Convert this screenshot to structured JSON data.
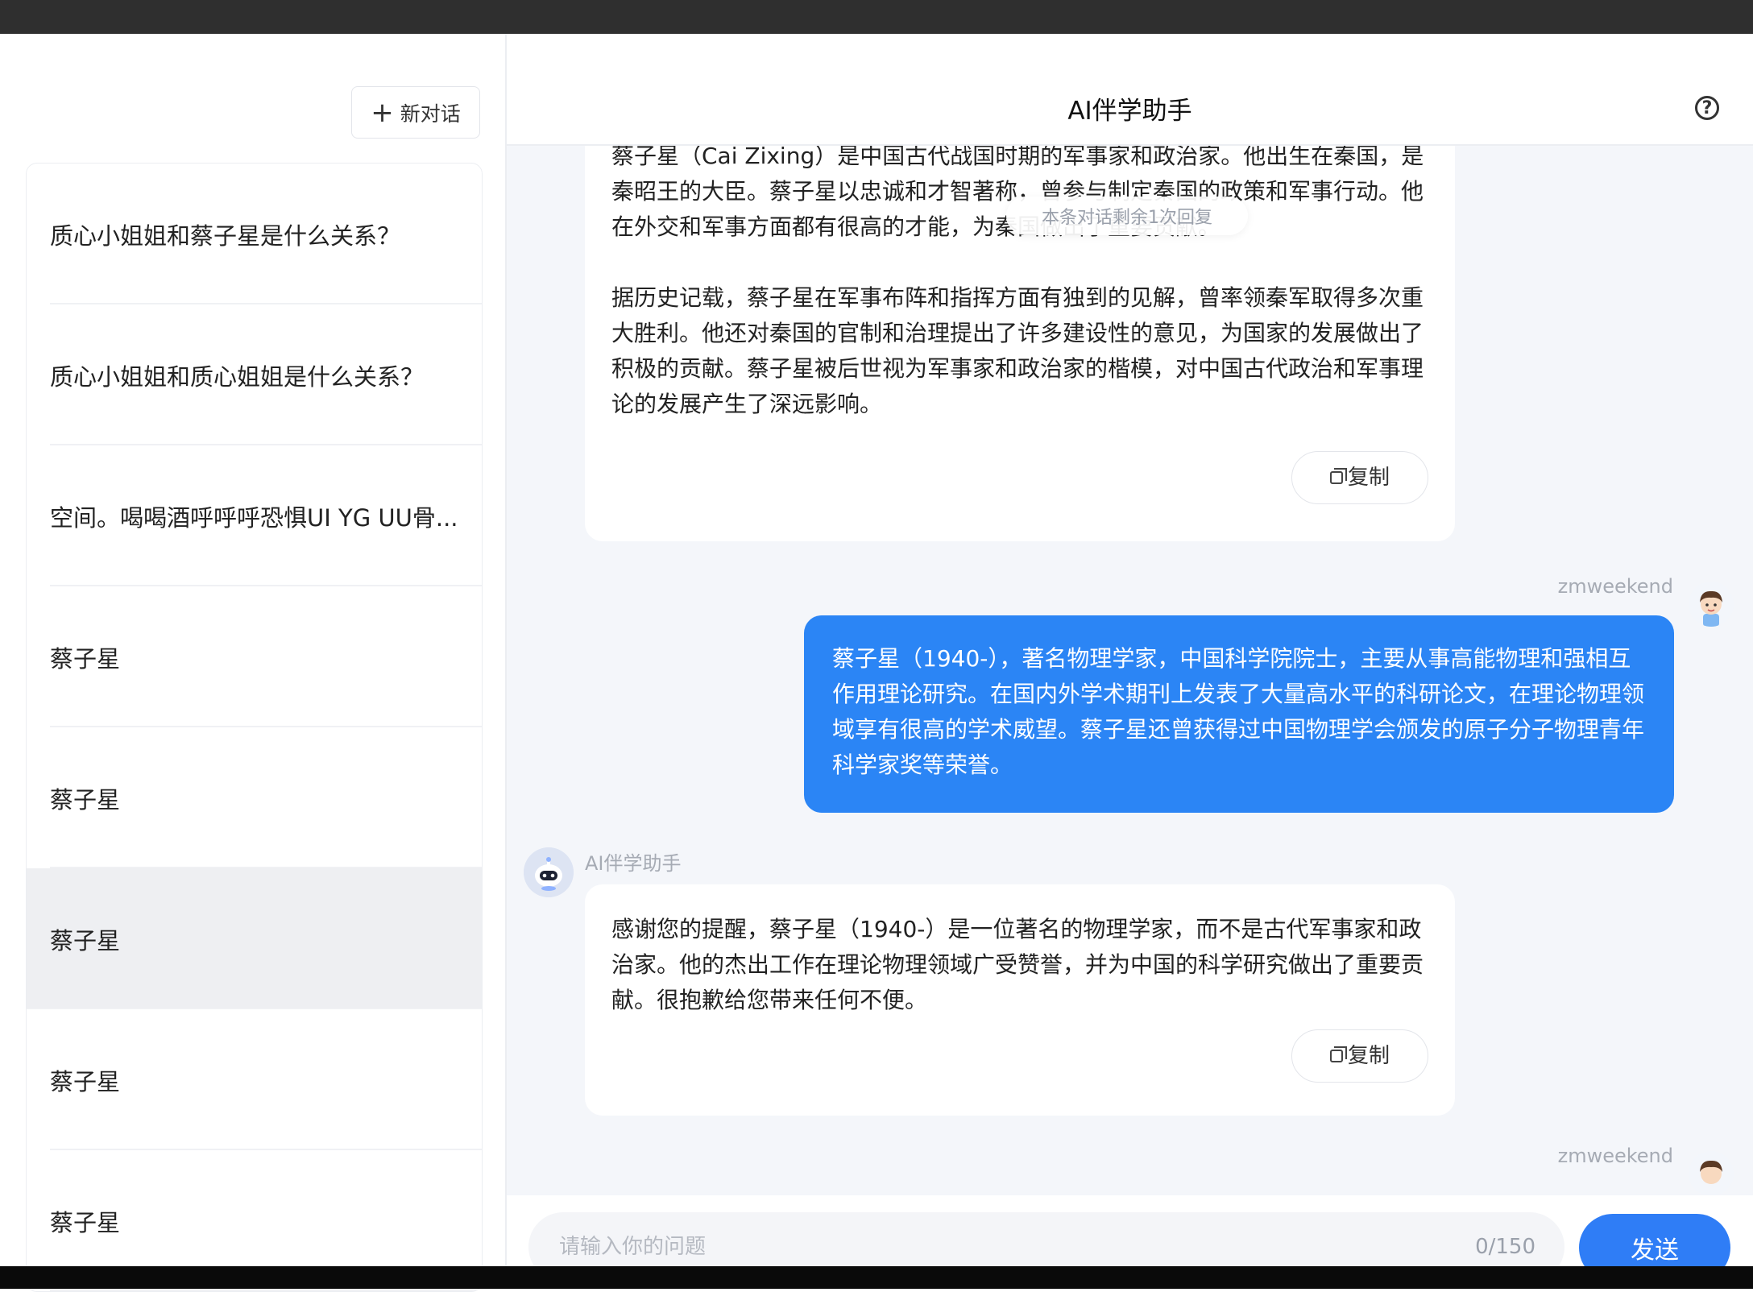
{
  "header": {
    "title": "AI伴学助手"
  },
  "sidebar": {
    "new_chat_label": "新对话",
    "conversations": [
      {
        "title": "质心小姐姐和蔡子星是什么关系？"
      },
      {
        "title": "质心小姐姐和质心姐姐是什么关系？"
      },
      {
        "title": "空间。喝喝酒呼呼呼恐惧UI YG UU骨..."
      },
      {
        "title": "蔡子星"
      },
      {
        "title": "蔡子星"
      },
      {
        "title": "蔡子星"
      },
      {
        "title": "蔡子星"
      },
      {
        "title": "蔡子星"
      }
    ]
  },
  "chat": {
    "remaining_notice": "本条对话剩余1次回复",
    "messages": [
      {
        "role": "assistant",
        "paragraphs": [
          "蔡子星（Cai Zixing）是中国古代战国时期的军事家和政治家。他出生在秦国，是秦昭王的大臣。蔡子星以忠诚和才智著称，曾参与制定秦国的政策和军事行动。他在外交和军事方面都有很高的才能，为秦国做出了重要贡献。",
          "据历史记载，蔡子星在军事布阵和指挥方面有独到的见解，曾率领秦军取得多次重大胜利。他还对秦国的官制和治理提出了许多建设性的意见，为国家的发展做出了积极的贡献。蔡子星被后世视为军事家和政治家的楷模，对中国古代政治和军事理论的发展产生了深远影响。"
        ],
        "copy_label": "复制"
      },
      {
        "role": "user",
        "username": "zmweekend",
        "text": "蔡子星（1940-），著名物理学家，中国科学院院士，主要从事高能物理和强相互作用理论研究。在国内外学术期刊上发表了大量高水平的科研论文，在理论物理领域享有很高的学术威望。蔡子星还曾获得过中国物理学会颁发的原子分子物理青年科学家奖等荣誉。"
      },
      {
        "role": "assistant",
        "name": "AI伴学助手",
        "paragraphs": [
          "感谢您的提醒，蔡子星（1940-）是一位著名的物理学家，而不是古代军事家和政治家。他的杰出工作在理论物理领域广受赞誉，并为中国的科学研究做出了重要贡献。很抱歉给您带来任何不便。"
        ],
        "copy_label": "复制"
      },
      {
        "role": "user",
        "username": "zmweekend"
      }
    ]
  },
  "input": {
    "placeholder": "请输入你的问题",
    "counter": "0/150",
    "send_label": "发送"
  },
  "colors": {
    "accent": "#2b85f5",
    "send_button": "#2f7df6",
    "chat_background": "#f4f6fa",
    "active_conversation": "#eeeff2"
  },
  "icons": {
    "new_chat": "plus-icon",
    "help": "question-circle-icon",
    "copy": "copy-icon",
    "user_avatar": "cartoon-boy-avatar",
    "assistant_avatar": "robot-avatar"
  }
}
